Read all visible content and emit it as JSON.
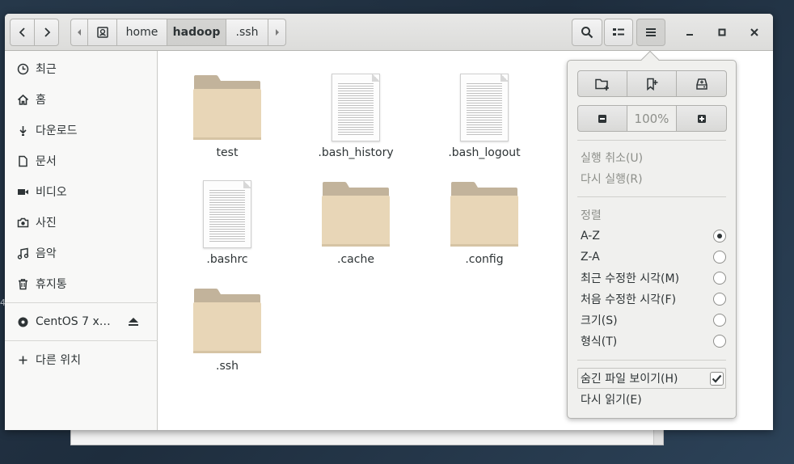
{
  "edge_char": "4",
  "nav": {
    "back": "back",
    "forward": "forward"
  },
  "pathbar": {
    "crumbs": [
      "home",
      "hadoop",
      ".ssh"
    ],
    "current": "hadoop"
  },
  "sidebar": {
    "items": [
      {
        "label": "최근",
        "icon": "recent-icon"
      },
      {
        "label": "홈",
        "icon": "home-icon"
      },
      {
        "label": "다운로드",
        "icon": "download-icon"
      },
      {
        "label": "문서",
        "icon": "document-icon"
      },
      {
        "label": "비디오",
        "icon": "video-icon"
      },
      {
        "label": "사진",
        "icon": "camera-icon"
      },
      {
        "label": "음악",
        "icon": "music-icon"
      },
      {
        "label": "휴지통",
        "icon": "trash-icon"
      }
    ],
    "device": {
      "label": "CentOS 7 x…",
      "icon": "disc-icon"
    },
    "other": {
      "label": "다른 위치",
      "icon": "plus-icon"
    }
  },
  "files": [
    {
      "name": "test",
      "type": "folder"
    },
    {
      "name": ".bash_history",
      "type": "document"
    },
    {
      "name": ".bash_logout",
      "type": "document"
    },
    {
      "name": ".bashrc",
      "type": "document"
    },
    {
      "name": ".cache",
      "type": "folder"
    },
    {
      "name": ".config",
      "type": "folder"
    },
    {
      "name": ".ssh",
      "type": "folder"
    }
  ],
  "menu": {
    "zoom": "100%",
    "undo": "실행 취소(U)",
    "redo": "다시 실행(R)",
    "sort_header": "정렬",
    "sort_options": [
      {
        "label": "A-Z",
        "selected": true
      },
      {
        "label": "Z-A",
        "selected": false
      },
      {
        "label": "최근 수정한 시각(M)",
        "selected": false
      },
      {
        "label": "처음 수정한 시각(F)",
        "selected": false
      },
      {
        "label": "크기(S)",
        "selected": false
      },
      {
        "label": "형식(T)",
        "selected": false
      }
    ],
    "show_hidden": {
      "label": "숨긴 파일 보이기(H)",
      "checked": true
    },
    "reload": "다시 읽기(E)"
  },
  "colors": {
    "folder_tab": "#c2b39b",
    "folder_body": "#e8d6b7",
    "headerbar": "#e0e0de",
    "sidebar": "#f8f8f7"
  }
}
